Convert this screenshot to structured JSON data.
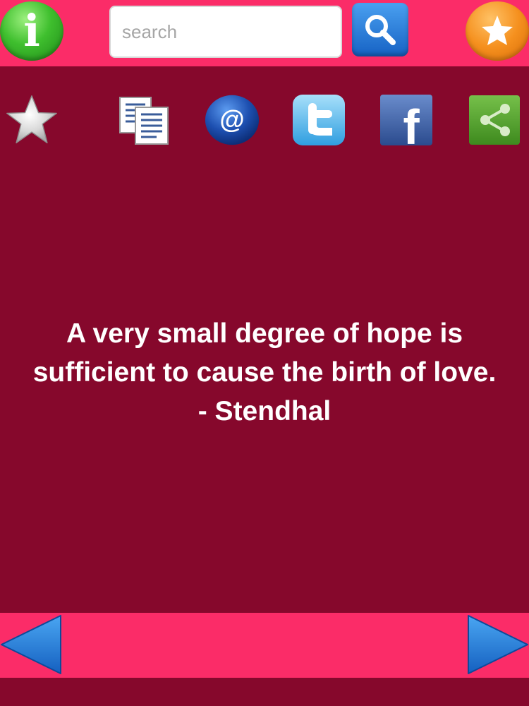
{
  "header": {
    "info_icon": "info-icon",
    "info_glyph": "i",
    "search": {
      "placeholder": "search",
      "value": ""
    },
    "search_icon": "magnifier-icon",
    "favorite_icon": "star-icon"
  },
  "toolbar": {
    "icons": [
      "star-icon",
      "copy-icon",
      "email-icon",
      "twitter-icon",
      "facebook-icon",
      "share-icon"
    ],
    "email_glyph": "@",
    "facebook_glyph": "f"
  },
  "quote": {
    "text": "A very small degree of hope is sufficient to cause the birth of love. - Stendhal"
  },
  "footer": {
    "prev_icon": "arrow-left-icon",
    "next_icon": "arrow-right-icon"
  },
  "colors": {
    "bar": "#fb2c68",
    "background": "#86082c",
    "text": "#ffffff"
  }
}
